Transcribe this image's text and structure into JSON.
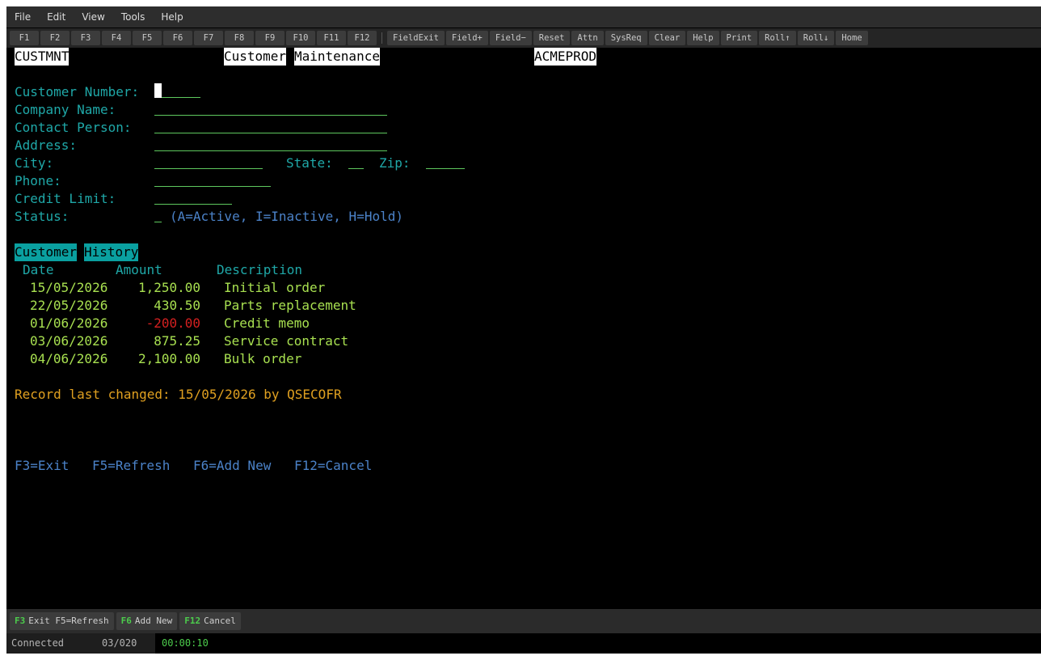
{
  "menu": [
    "File",
    "Edit",
    "View",
    "Tools",
    "Help"
  ],
  "toolbar": {
    "fkeys": [
      "F1",
      "F2",
      "F3",
      "F4",
      "F5",
      "F6",
      "F7",
      "F8",
      "F9",
      "F10",
      "F11",
      "F12"
    ],
    "actions": [
      "FieldExit",
      "Field+",
      "Field−",
      "Reset",
      "Attn",
      "SysReq",
      "Clear",
      "Help",
      "Print",
      "Roll↑",
      "Roll↓",
      "Home"
    ]
  },
  "screen": {
    "program": "CUSTMNT",
    "title_word1": "Customer",
    "title_word2": "Maintenance",
    "system": "ACMEPROD",
    "fields": {
      "customer_number": "Customer Number:",
      "company_name": "Company Name:",
      "contact_person": "Contact Person:",
      "address": "Address:",
      "city": "City:",
      "state": "State:",
      "zip": "Zip:",
      "phone": "Phone:",
      "credit_limit": "Credit Limit:",
      "status": "Status:",
      "status_hint": "(A=Active, I=Inactive, H=Hold)"
    },
    "history": {
      "title_word1": "Customer",
      "title_word2": "History",
      "headers": {
        "date": "Date",
        "amount": "Amount",
        "description": "Description"
      },
      "rows": [
        {
          "date": "15/05/2026",
          "amount": "1,250.00",
          "description": "Initial order",
          "negative": false
        },
        {
          "date": "22/05/2026",
          "amount": "430.50",
          "description": "Parts replacement",
          "negative": false
        },
        {
          "date": "01/06/2026",
          "amount": "-200.00",
          "description": "Credit memo",
          "negative": true
        },
        {
          "date": "03/06/2026",
          "amount": "875.25",
          "description": "Service contract",
          "negative": false
        },
        {
          "date": "04/06/2026",
          "amount": "2,100.00",
          "description": "Bulk order",
          "negative": false
        }
      ]
    },
    "record_changed": "Record last changed: 15/05/2026 by QSECOFR",
    "fkey_line": {
      "f3": "F3=Exit",
      "f5": "F5=Refresh",
      "f6": "F6=Add New",
      "f12": "F12=Cancel"
    }
  },
  "fkeybar": [
    {
      "key": "F3",
      "label": "Exit F5=Refresh"
    },
    {
      "key": "F6",
      "label": "Add New"
    },
    {
      "key": "F12",
      "label": "Cancel"
    }
  ],
  "status": {
    "connection": "Connected",
    "cursor_pos": "03/020",
    "timer": "00:00:10"
  },
  "colors": {
    "label": "#1fa8a8",
    "data": "#a8e050",
    "negative": "#d42020",
    "hint": "#4b82c8",
    "info": "#e0a020",
    "field_underline": "#5ec85e"
  }
}
